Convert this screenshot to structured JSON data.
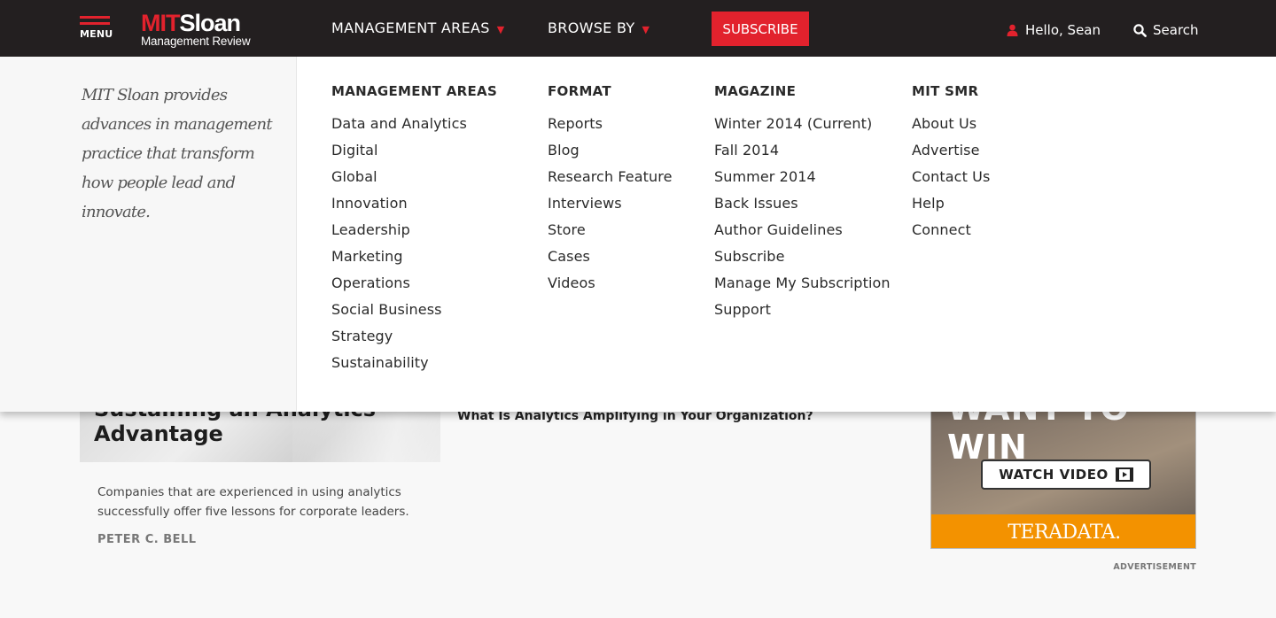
{
  "header": {
    "menu_label": "MENU",
    "logo_mit": "MIT",
    "logo_sloan": "Sloan",
    "logo_sub": "Management Review",
    "nav": [
      {
        "label": "MANAGEMENT AREAS",
        "caret": "▼"
      },
      {
        "label": "BROWSE BY",
        "caret": "▼"
      }
    ],
    "subscribe_label": "SUBSCRIBE",
    "user_label": "Hello, Sean",
    "search_label": "Search",
    "icons": {
      "menu": "hamburger-icon",
      "user": "user-icon",
      "search": "search-icon"
    },
    "colors": {
      "bar": "#231f20",
      "accent": "#e2222d"
    }
  },
  "dropdown": {
    "tagline": "MIT Sloan provides advances in management practice that transform how people lead and innovate.",
    "columns": [
      {
        "heading": "MANAGEMENT AREAS",
        "items": [
          "Data and Analytics",
          "Digital",
          "Global",
          "Innovation",
          "Leadership",
          "Marketing",
          "Operations",
          "Social Business",
          "Strategy",
          "Sustainability"
        ]
      },
      {
        "heading": "FORMAT",
        "items": [
          "Reports",
          "Blog",
          "Research Feature",
          "Interviews",
          "Store",
          "Cases",
          "Videos"
        ]
      },
      {
        "heading": "MAGAZINE",
        "items": [
          "Winter 2014 (Current)",
          "Fall 2014",
          "Summer 2014",
          "Back Issues",
          "Author Guidelines",
          "Subscribe",
          "Manage My Subscription",
          "Support"
        ]
      },
      {
        "heading": "MIT SMR",
        "items": [
          "About Us",
          "Advertise",
          "Contact Us",
          "Help",
          "Connect"
        ]
      }
    ]
  },
  "content": {
    "hero_title": "Sustaining an Analytics Advantage",
    "hero_desc": "Companies that are experienced in using analytics successfully offer five lessons for corporate leaders.",
    "hero_author": "PETER C. BELL",
    "mid_headline": "What Is Analytics Amplifying in Your Organization?"
  },
  "ad": {
    "headline": "WANT TO WIN",
    "watch_label": "WATCH VIDEO",
    "brand": "TERADATA.",
    "label": "ADVERTISEMENT",
    "colors": {
      "brand_bar": "#f39200"
    }
  }
}
